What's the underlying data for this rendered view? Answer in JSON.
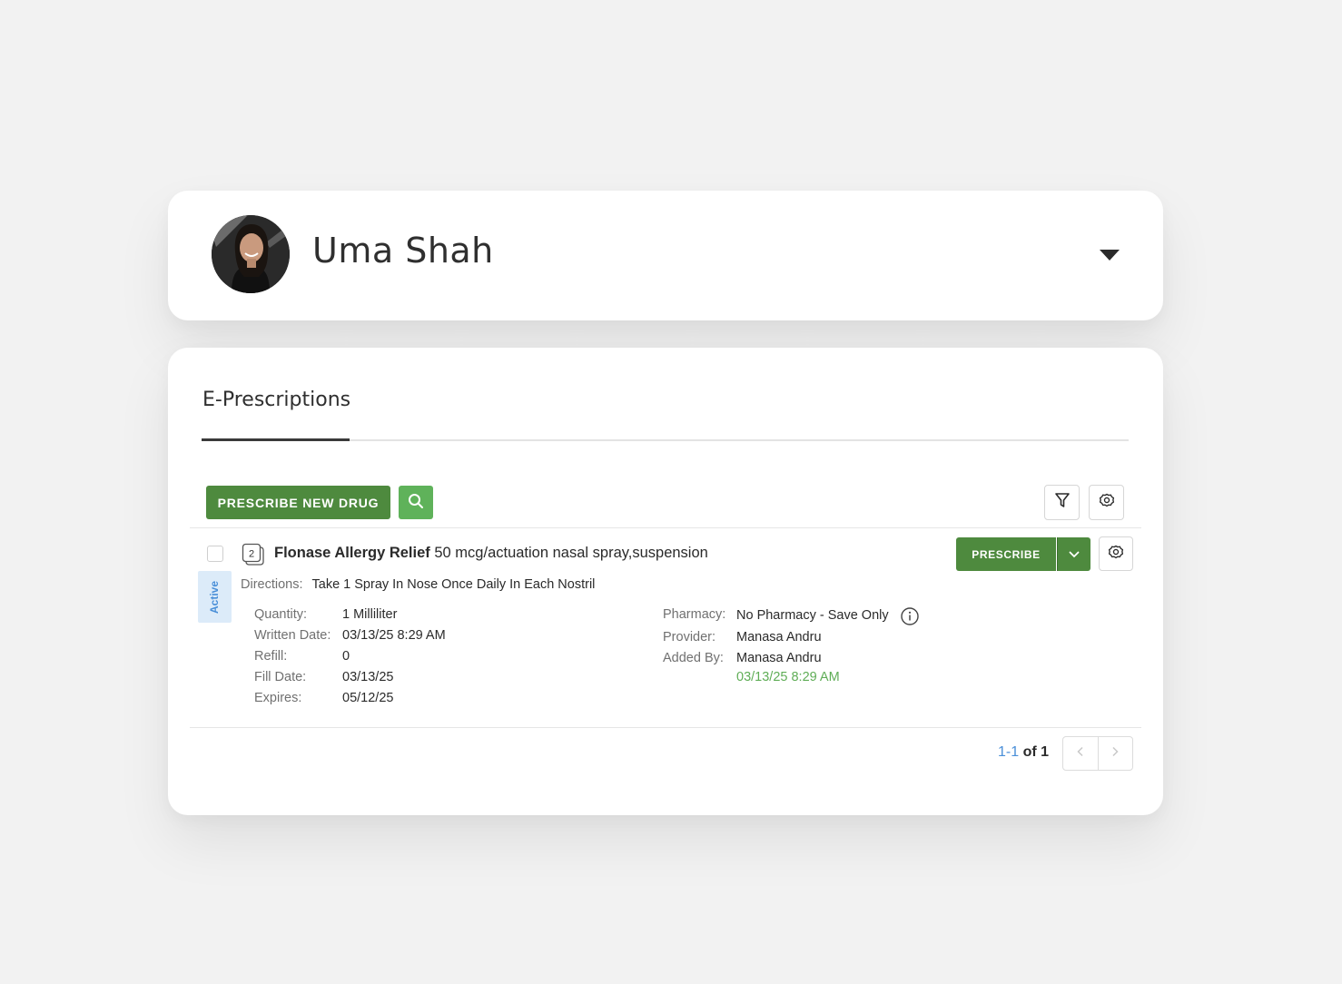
{
  "patient": {
    "name": "Uma Shah"
  },
  "eprescriptions": {
    "tab_label": "E-Prescriptions",
    "toolbar": {
      "prescribe_new_label": "PRESCRIBE NEW DRUG",
      "search_icon": "search-icon",
      "filter_icon": "filter-icon",
      "settings_icon": "gear-icon"
    },
    "rows": [
      {
        "status": "Active",
        "refill_count_badge": "2",
        "drug_name": "Flonase Allergy Relief",
        "drug_detail": "50 mcg/actuation nasal spray,suspension",
        "directions_label": "Directions:",
        "directions": "Take 1 Spray In Nose Once Daily In Each Nostril",
        "quantity_label": "Quantity:",
        "quantity": "1 Milliliter",
        "written_date_label": "Written Date:",
        "written_date": "03/13/25 8:29 AM",
        "refill_label": "Refill:",
        "refill": "0",
        "fill_date_label": "Fill Date:",
        "fill_date": "03/13/25",
        "expires_label": "Expires:",
        "expires": "05/12/25",
        "pharmacy_label": "Pharmacy:",
        "pharmacy": "No Pharmacy - Save Only",
        "provider_label": "Provider:",
        "provider": "Manasa Andru",
        "added_by_label": "Added By:",
        "added_by": "Manasa Andru",
        "added_at": "03/13/25 8:29 AM",
        "prescribe_label": "PRESCRIBE"
      }
    ],
    "pagination": {
      "range": "1-1",
      "of_total": "of 1"
    }
  },
  "colors": {
    "primary_green": "#4e8a3e",
    "search_green": "#5fb25a",
    "timestamp_green": "#5fad56",
    "status_blue": "#4a8fd8",
    "status_bg": "#dcebf9"
  }
}
